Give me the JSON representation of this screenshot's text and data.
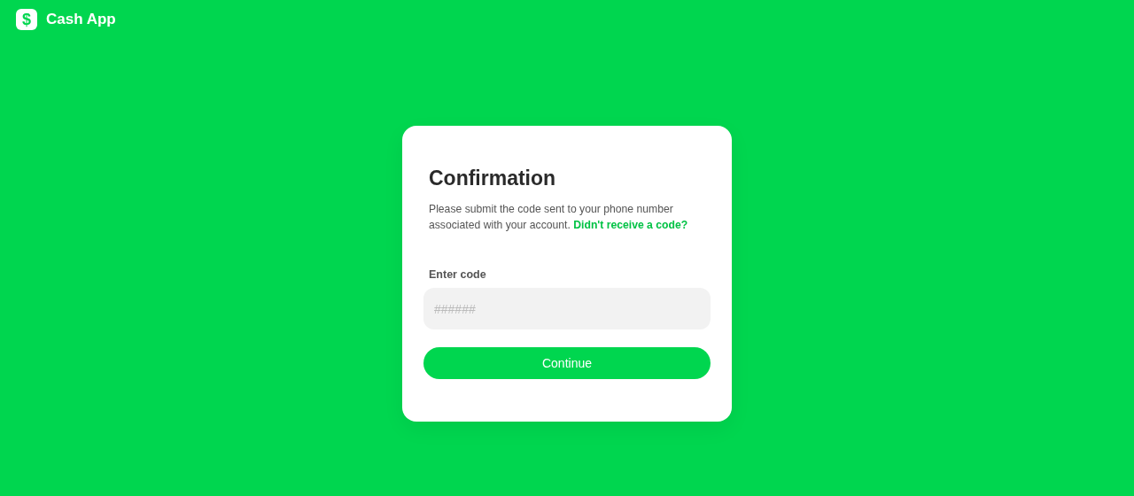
{
  "header": {
    "logo_glyph": "$",
    "brand": "Cash App"
  },
  "card": {
    "title": "Confirmation",
    "message": "Please submit the code sent to your phone number associated with your account.",
    "link": "Didn't receive a code?",
    "field_label": "Enter code",
    "field_placeholder": "######",
    "button": "Continue"
  }
}
